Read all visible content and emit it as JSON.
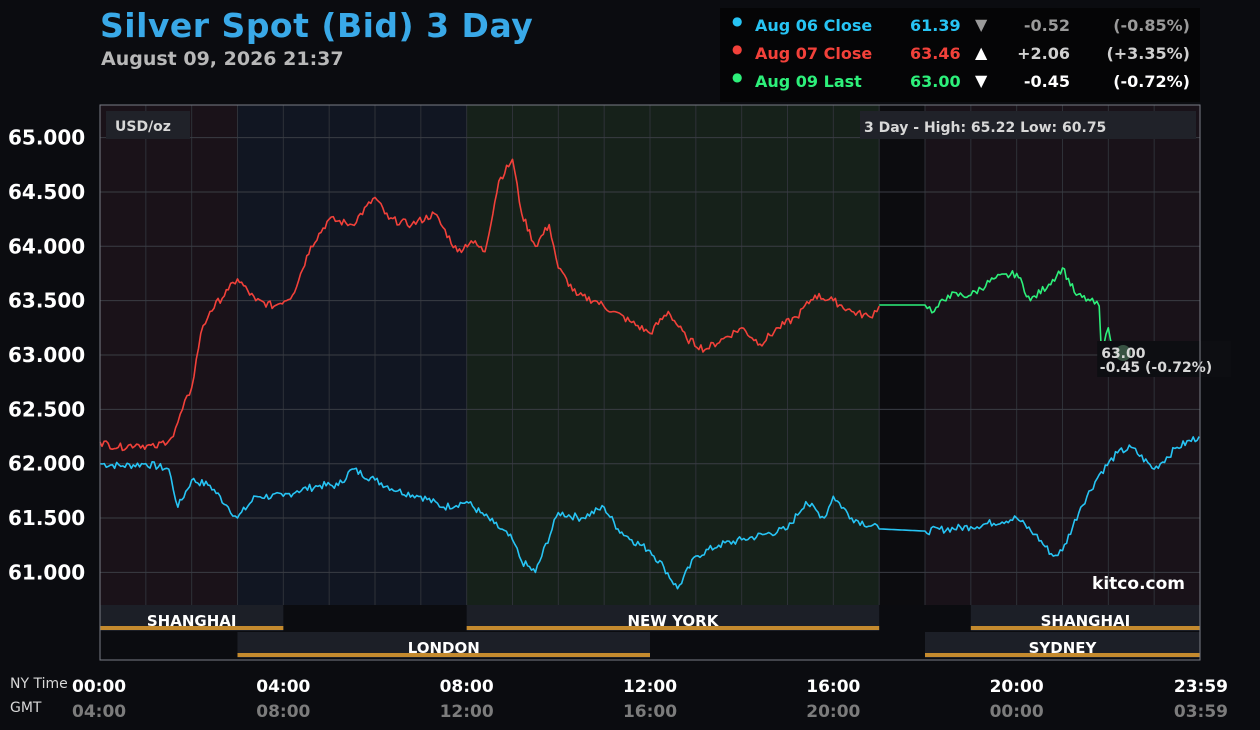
{
  "header": {
    "title": "Silver Spot (Bid) 3 Day",
    "timestamp": "August 09, 2026 21:37"
  },
  "summary": [
    {
      "label": "Aug 06 Close",
      "value": "61.39",
      "arrow": "▼",
      "change": "-0.52",
      "pct": "(-0.85%)",
      "color": "#27c4f4",
      "text_color": "#9a9a9a",
      "arrow_color": "#9a9a9a"
    },
    {
      "label": "Aug 07 Close",
      "value": "63.46",
      "arrow": "▲",
      "change": "+2.06",
      "pct": "(+3.35%)",
      "color": "#f2413a",
      "text_color": "#d0d0d0",
      "arrow_color": "#ffffff"
    },
    {
      "label": "Aug 09 Last",
      "value": "63.00",
      "arrow": "▼",
      "change": "-0.45",
      "pct": "(-0.72%)",
      "color": "#2df07a",
      "text_color": "#ffffff",
      "arrow_color": "#ffffff"
    }
  ],
  "chart_data": {
    "type": "line",
    "unit_label": "USD/oz",
    "range_note": "3 Day - High: 65.22  Low: 60.75",
    "ylim": [
      60.7,
      65.3
    ],
    "y_ticks": [
      65.0,
      64.5,
      64.0,
      63.5,
      63.0,
      62.5,
      62.0,
      61.5,
      61.0
    ],
    "y_tick_labels": [
      "65.000",
      "64.500",
      "64.000",
      "63.500",
      "63.000",
      "62.500",
      "62.000",
      "61.500",
      "61.000"
    ],
    "xlim": [
      0,
      24
    ],
    "x_ticks_ny": [
      {
        "h": 0,
        "label": "00:00"
      },
      {
        "h": 4,
        "label": "04:00"
      },
      {
        "h": 8,
        "label": "08:00"
      },
      {
        "h": 12,
        "label": "12:00"
      },
      {
        "h": 16,
        "label": "16:00"
      },
      {
        "h": 20,
        "label": "20:00"
      },
      {
        "h": 23.983,
        "label": "23:59"
      }
    ],
    "x_ticks_gmt": [
      "04:00",
      "08:00",
      "12:00",
      "16:00",
      "20:00",
      "00:00",
      "03:59"
    ],
    "x_axis_ny_label": "NY Time",
    "x_axis_gmt_label": "GMT",
    "watermark": "kitco.com",
    "last_label": {
      "price": "63.00",
      "change": "-0.45 (-0.72%)"
    },
    "sessions": [
      {
        "name": "SHANGHAI",
        "start": 0,
        "end": 4
      },
      {
        "name": "LONDON",
        "start": 3,
        "end": 12
      },
      {
        "name": "NEW YORK",
        "start": 8,
        "end": 17
      },
      {
        "name": "SHANGHAI",
        "start": 19,
        "end": 24
      },
      {
        "name": "SYDNEY",
        "start": 18,
        "end": 24
      }
    ],
    "series": [
      {
        "color": "#27c4f4",
        "x": [
          0,
          0.5,
          1,
          1.5,
          1.7,
          2,
          2.4,
          2.8,
          3,
          3.4,
          4,
          4.3,
          4.8,
          5.2,
          5.5,
          6,
          6.5,
          7,
          7.5,
          8,
          8.3,
          8.6,
          9,
          9.2,
          9.5,
          10,
          10.5,
          11,
          11.3,
          11.6,
          12,
          12.3,
          12.6,
          13,
          13.5,
          14,
          14.5,
          15,
          15.4,
          15.8,
          16,
          16.4,
          17,
          18,
          19,
          20,
          20.4,
          20.8,
          21,
          21.4,
          21.8,
          22.2,
          22.5,
          23,
          23.5,
          23.983
        ],
        "y": [
          62.0,
          61.98,
          62.0,
          61.95,
          61.6,
          61.85,
          61.8,
          61.6,
          61.5,
          61.7,
          61.7,
          61.75,
          61.8,
          61.8,
          61.95,
          61.85,
          61.75,
          61.7,
          61.6,
          61.65,
          61.55,
          61.45,
          61.3,
          61.1,
          61.0,
          61.55,
          61.5,
          61.6,
          61.4,
          61.3,
          61.2,
          61.05,
          60.85,
          61.15,
          61.25,
          61.3,
          61.35,
          61.4,
          61.65,
          61.5,
          61.7,
          61.5,
          61.4,
          61.38,
          61.42,
          61.5,
          61.35,
          61.15,
          61.2,
          61.6,
          61.9,
          62.1,
          62.15,
          61.95,
          62.15,
          62.25
        ]
      },
      {
        "color": "#f2413a",
        "x": [
          0,
          0.4,
          0.8,
          1.2,
          1.6,
          1.8,
          2,
          2.2,
          2.4,
          2.8,
          3,
          3.4,
          3.8,
          4.2,
          4.6,
          5,
          5.5,
          6,
          6.3,
          6.8,
          7.3,
          7.8,
          8.1,
          8.4,
          8.7,
          9,
          9.2,
          9.5,
          9.8,
          10,
          10.4,
          10.8,
          11.2,
          11.6,
          12,
          12.4,
          12.8,
          13.2,
          13.6,
          14,
          14.4,
          14.8,
          15.2,
          15.6,
          16,
          16.4,
          16.8,
          17
        ],
        "y": [
          62.2,
          62.15,
          62.18,
          62.15,
          62.25,
          62.5,
          62.7,
          63.2,
          63.4,
          63.6,
          63.7,
          63.5,
          63.45,
          63.55,
          64.0,
          64.25,
          64.2,
          64.45,
          64.25,
          64.2,
          64.3,
          63.95,
          64.05,
          63.95,
          64.6,
          64.8,
          64.3,
          64.0,
          64.2,
          63.8,
          63.55,
          63.5,
          63.4,
          63.3,
          63.2,
          63.4,
          63.15,
          63.05,
          63.15,
          63.25,
          63.1,
          63.25,
          63.35,
          63.55,
          63.5,
          63.4,
          63.35,
          63.45
        ]
      },
      {
        "color": "#2df07a",
        "x": [
          17,
          18,
          18.2,
          18.5,
          19,
          19.5,
          20,
          20.3,
          20.7,
          21,
          21.3,
          21.6,
          21.8,
          21.85,
          22,
          22.15
        ],
        "y": [
          63.46,
          63.46,
          63.4,
          63.55,
          63.55,
          63.7,
          63.75,
          63.5,
          63.65,
          63.8,
          63.55,
          63.5,
          63.45,
          63.0,
          63.25,
          63.0
        ]
      }
    ]
  }
}
